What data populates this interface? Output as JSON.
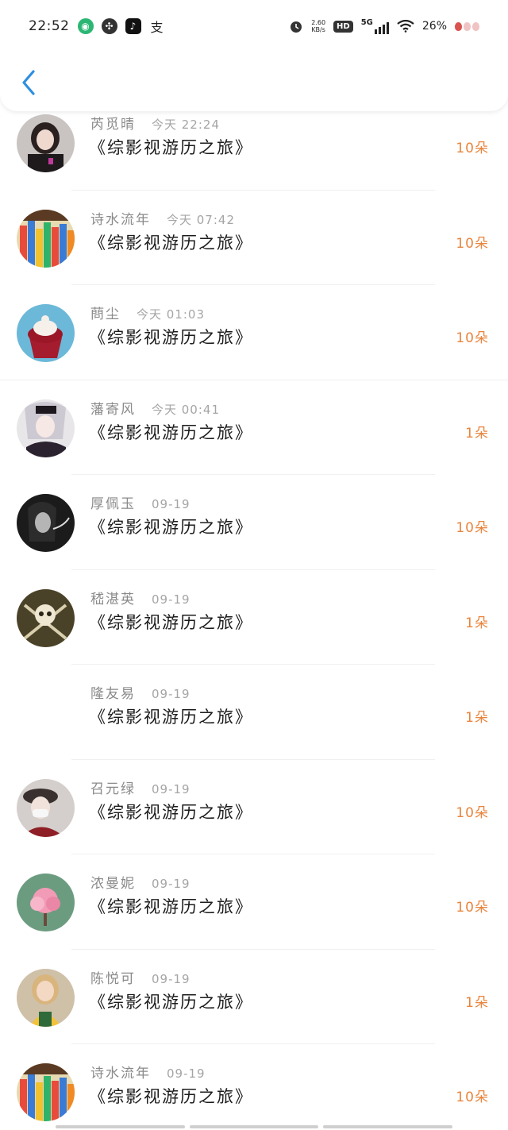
{
  "status_bar": {
    "time": "22:52",
    "speed_top": "2.60",
    "speed_bottom": "KB/s",
    "hd": "HD",
    "network": "5G",
    "battery": "26%",
    "app_text_icon": "支"
  },
  "colors": {
    "accent_back": "#2f8fe0",
    "amount": "#e8853d",
    "name": "#8a8a8a",
    "title": "#1c1c1c"
  },
  "gifts": [
    {
      "user": "芮觅晴",
      "time": "今天 22:24",
      "title": "《综影视游历之旅》",
      "amount": "10朵",
      "avatar": "dark-hair-girl"
    },
    {
      "user": "诗水流年",
      "time": "今天 07:42",
      "title": "《综影视游历之旅》",
      "amount": "10朵",
      "avatar": "colored-pencils"
    },
    {
      "user": "蔄尘",
      "time": "今天 01:03",
      "title": "《综影视游历之旅》",
      "amount": "10朵",
      "avatar": "cupcake"
    },
    {
      "user": "藩寄风",
      "time": "今天 00:41",
      "title": "《综影视游历之旅》",
      "amount": "1朵",
      "avatar": "anime-girl"
    },
    {
      "user": "厚佩玉",
      "time": "09-19",
      "title": "《综影视游历之旅》",
      "amount": "10朵",
      "avatar": "bw-smoking-woman"
    },
    {
      "user": "嵇湛英",
      "time": "09-19",
      "title": "《综影视游历之旅》",
      "amount": "1朵",
      "avatar": "pirate-skull"
    },
    {
      "user": "隆友易",
      "time": "09-19",
      "title": "《综影视游历之旅》",
      "amount": "1朵",
      "avatar": ""
    },
    {
      "user": "召元绿",
      "time": "09-19",
      "title": "《综影视游历之旅》",
      "amount": "10朵",
      "avatar": "masked-person"
    },
    {
      "user": "浓曼妮",
      "time": "09-19",
      "title": "《综影视游历之旅》",
      "amount": "10朵",
      "avatar": "pink-tree"
    },
    {
      "user": "陈悦可",
      "time": "09-19",
      "title": "《综影视游历之旅》",
      "amount": "1朵",
      "avatar": "little-girl"
    },
    {
      "user": "诗水流年",
      "time": "09-19",
      "title": "《综影视游历之旅》",
      "amount": "10朵",
      "avatar": "colored-pencils"
    }
  ]
}
